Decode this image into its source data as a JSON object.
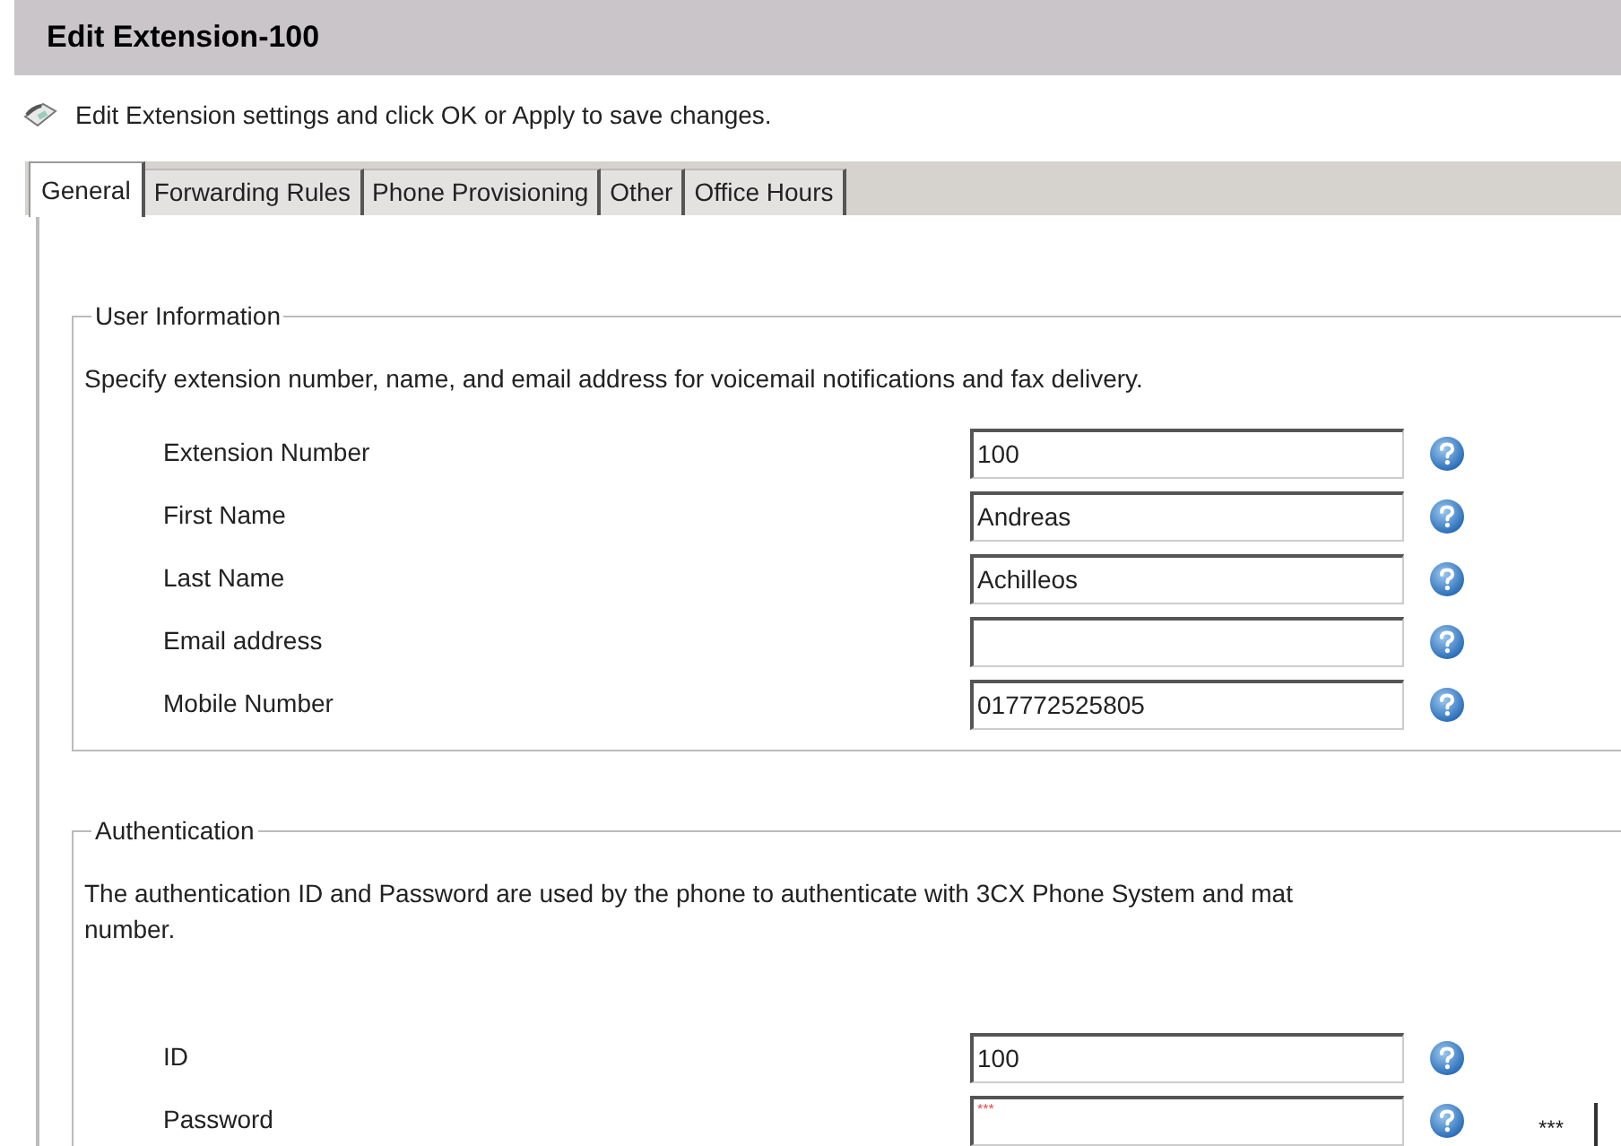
{
  "header": {
    "title": "Edit Extension-100"
  },
  "hint": "Edit Extension settings and click OK or Apply to save changes.",
  "tabs": [
    {
      "label": "General",
      "selected": true
    },
    {
      "label": "Forwarding Rules",
      "selected": false
    },
    {
      "label": "Phone Provisioning",
      "selected": false
    },
    {
      "label": "Other",
      "selected": false
    },
    {
      "label": "Office Hours",
      "selected": false
    }
  ],
  "sections": [
    {
      "legend": "User Information",
      "description": "Specify extension number, name, and email address for voicemail notifications and fax delivery.",
      "fields": [
        {
          "label": "Extension Number",
          "value": "100",
          "kind": "text"
        },
        {
          "label": "First Name",
          "value": "Andreas",
          "kind": "text"
        },
        {
          "label": "Last Name",
          "value": "Achilleos",
          "kind": "text"
        },
        {
          "label": "Email address",
          "kind": "text"
        },
        {
          "label": "Mobile Number",
          "value": "017772525805",
          "kind": "text"
        }
      ]
    },
    {
      "legend": "Authentication",
      "description": "The authentication ID and Password are used by the phone to authenticate with 3CX Phone System and mat\nnumber.",
      "fields": [
        {
          "label": "ID",
          "value": "100",
          "kind": "text"
        },
        {
          "label": "Password",
          "value": "***",
          "kind": "password",
          "button": "***"
        }
      ]
    }
  ]
}
